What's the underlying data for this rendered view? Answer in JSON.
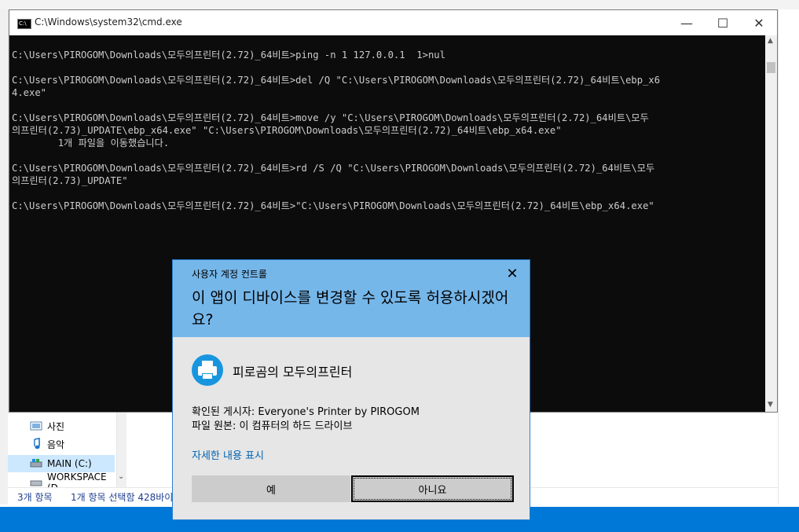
{
  "cmd": {
    "title": "C:\\Windows\\system32\\cmd.exe",
    "lines": [
      "C:\\Users\\PIROGOM\\Downloads\\모두의프린터(2.72)_64비트>ping -n 1 127.0.0.1  1>nul",
      "",
      "C:\\Users\\PIROGOM\\Downloads\\모두의프린터(2.72)_64비트>del /Q \"C:\\Users\\PIROGOM\\Downloads\\모두의프린터(2.72)_64비트\\ebp_x6",
      "4.exe\"",
      "",
      "C:\\Users\\PIROGOM\\Downloads\\모두의프린터(2.72)_64비트>move /y \"C:\\Users\\PIROGOM\\Downloads\\모두의프린터(2.72)_64비트\\모두",
      "의프린터(2.73)_UPDATE\\ebp_x64.exe\" \"C:\\Users\\PIROGOM\\Downloads\\모두의프린터(2.72)_64비트\\ebp_x64.exe\"",
      "        1개 파일을 이동했습니다.",
      "",
      "C:\\Users\\PIROGOM\\Downloads\\모두의프린터(2.72)_64비트>rd /S /Q \"C:\\Users\\PIROGOM\\Downloads\\모두의프린터(2.72)_64비트\\모두",
      "의프린터(2.73)_UPDATE\"",
      "",
      "C:\\Users\\PIROGOM\\Downloads\\모두의프린터(2.72)_64비트>\"C:\\Users\\PIROGOM\\Downloads\\모두의프린터(2.72)_64비트\\ebp_x64.exe\""
    ],
    "minimize_glyph": "—",
    "maximize_glyph": "☐",
    "close_glyph": "✕"
  },
  "explorer": {
    "nav_items": [
      {
        "label": "사진",
        "icon": "pictures-icon"
      },
      {
        "label": "음악",
        "icon": "music-icon"
      },
      {
        "label": "MAIN (C:)",
        "icon": "drive-icon",
        "selected": true
      },
      {
        "label": "WORKSPACE (D",
        "icon": "drive-icon"
      }
    ],
    "status_items": "3개 항목",
    "status_selected": "1개 항목 선택함 428바이"
  },
  "uac": {
    "caption": "사용자 계정 컨트롤",
    "question": "이 앱이 디바이스를 변경할 수 있도록 허용하시겠어요?",
    "app_name": "피로곰의 모두의프린터",
    "publisher": "확인된 게시자: Everyone's Printer by PIROGOM",
    "origin": "파일 원본: 이 컴퓨터의 하드 드라이브",
    "details_link": "자세한 내용 표시",
    "yes_label": "예",
    "no_label": "아니요",
    "close_glyph": "✕"
  },
  "colors": {
    "desktop": "#0078d7",
    "uac_header": "#76b7ea",
    "uac_body": "#e6e6e6",
    "app_icon": "#1796df",
    "link": "#0063b1"
  }
}
